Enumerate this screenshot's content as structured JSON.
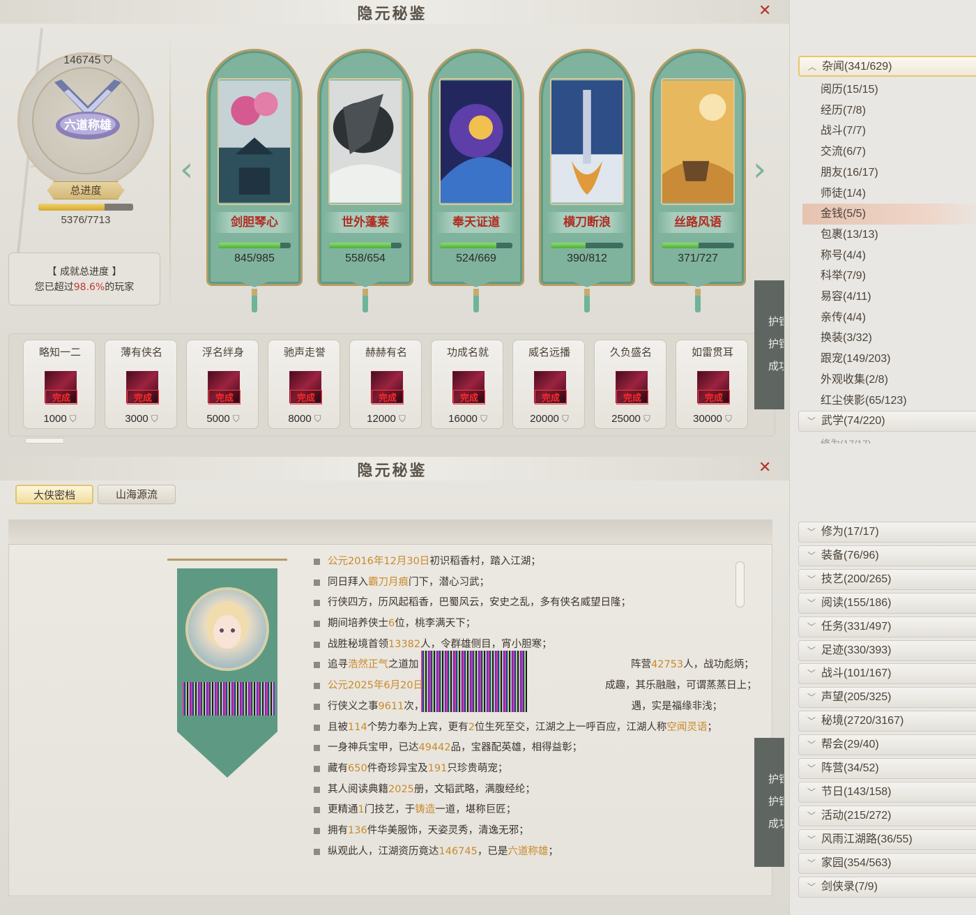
{
  "window_title": "隐元秘鉴",
  "top": {
    "total_score": "146745",
    "emblem_title": "六道称雄",
    "total_progress_label": "总进度",
    "progress_text": "5376/7713",
    "progress_fraction": 0.697,
    "summary_title": "【 成就总进度 】",
    "summary_prefix": "您已超过",
    "summary_pct": "98.6%",
    "summary_suffix": "的玩家",
    "cards": [
      {
        "name": "剑胆琴心",
        "count": "845/985",
        "fraction": 0.858
      },
      {
        "name": "世外蓬莱",
        "count": "558/654",
        "fraction": 0.853
      },
      {
        "name": "奉天证道",
        "count": "524/669",
        "fraction": 0.783
      },
      {
        "name": "横刀断浪",
        "count": "390/812",
        "fraction": 0.48
      },
      {
        "name": "丝路风语",
        "count": "371/727",
        "fraction": 0.51
      }
    ],
    "badges": [
      {
        "name": "略知一二",
        "status": "完成",
        "points": "1000"
      },
      {
        "name": "薄有侠名",
        "status": "完成",
        "points": "3000"
      },
      {
        "name": "浮名绊身",
        "status": "完成",
        "points": "5000"
      },
      {
        "name": "驰声走誉",
        "status": "完成",
        "points": "8000"
      },
      {
        "name": "赫赫有名",
        "status": "完成",
        "points": "12000"
      },
      {
        "name": "功成名就",
        "status": "完成",
        "points": "16000"
      },
      {
        "name": "威名远播",
        "status": "完成",
        "points": "20000"
      },
      {
        "name": "久负盛名",
        "status": "完成",
        "points": "25000"
      },
      {
        "name": "如雷贯耳",
        "status": "完成",
        "points": "30000"
      }
    ],
    "point_symbol": "⛉",
    "dark_tabs": [
      "护镖",
      "护镖",
      "成功"
    ]
  },
  "bottom": {
    "tabs": [
      "大侠密档",
      "山海源流"
    ],
    "lines": [
      [
        {
          "t": "公元2016年12月30日",
          "h": true
        },
        {
          "t": "初识稻香村，踏入江湖；"
        }
      ],
      [
        {
          "t": "同日拜入"
        },
        {
          "t": "霸刀月痕",
          "h": true
        },
        {
          "t": "门下，潜心习武；"
        }
      ],
      [
        {
          "t": "行侠四方，历风起稻香，巴蜀风云，安史之乱，多有侠名威望日隆；"
        }
      ],
      [
        {
          "t": "期间培养侠士"
        },
        {
          "t": "6",
          "h": true
        },
        {
          "t": "位，桃李满天下；"
        }
      ],
      [
        {
          "t": "战胜秘境首领"
        },
        {
          "t": "13382",
          "h": true
        },
        {
          "t": "人，令群雄侧目，宵小胆寒；"
        }
      ],
      [
        {
          "t": "追寻"
        },
        {
          "t": "浩然正气",
          "h": true
        },
        {
          "t": "之道加"
        },
        {
          "t": "　　　　　　　　　　　　　　　　　　　　　"
        },
        {
          "t": "阵营"
        },
        {
          "t": "42753",
          "h": true
        },
        {
          "t": "人，战功彪炳；"
        }
      ],
      [
        {
          "t": "公元2025年6月20日",
          "h": true
        },
        {
          "t": "　　　　　　　　　　　　　　　　　　"
        },
        {
          "t": "成趣，其乐融融，可谓蒸蒸日上；"
        }
      ],
      [
        {
          "t": "行侠义之事"
        },
        {
          "t": "9611",
          "h": true
        },
        {
          "t": "次，"
        },
        {
          "t": "　　　　　　　　　　　　　　　　　　　　　"
        },
        {
          "t": "遇，实是福缘非浅；"
        }
      ],
      [
        {
          "t": "且被"
        },
        {
          "t": "114",
          "h": true
        },
        {
          "t": "个势力奉为上宾，更有"
        },
        {
          "t": "2",
          "h": true
        },
        {
          "t": "位生死至交，江湖之上一呼百应，江湖人称"
        },
        {
          "t": "空闻灵语",
          "h": true
        },
        {
          "t": "；"
        }
      ],
      [
        {
          "t": "一身神兵宝甲，已达"
        },
        {
          "t": "49442",
          "h": true
        },
        {
          "t": "品，宝器配英雄，相得益彰；"
        }
      ],
      [
        {
          "t": "藏有"
        },
        {
          "t": "650",
          "h": true
        },
        {
          "t": "件奇珍异宝及"
        },
        {
          "t": "191",
          "h": true
        },
        {
          "t": "只珍贵萌宠；"
        }
      ],
      [
        {
          "t": "其人阅读典籍"
        },
        {
          "t": "2025",
          "h": true
        },
        {
          "t": "册，文韬武略，满腹经纶；"
        }
      ],
      [
        {
          "t": "更精通"
        },
        {
          "t": "1",
          "h": true
        },
        {
          "t": "门技艺，于"
        },
        {
          "t": "铸造",
          "h": true
        },
        {
          "t": "一道，堪称巨匠；"
        }
      ],
      [
        {
          "t": "拥有"
        },
        {
          "t": "136",
          "h": true
        },
        {
          "t": "件华美服饰，天姿灵秀，清逸无邪；"
        }
      ],
      [
        {
          "t": "纵观此人，江湖资历竟达"
        },
        {
          "t": "146745",
          "h": true
        },
        {
          "t": "，已是"
        },
        {
          "t": "六道称雄",
          "h": true
        },
        {
          "t": "；"
        }
      ]
    ],
    "dark_tabs": [
      "护镖",
      "护镖",
      "成功"
    ]
  },
  "sidebar": {
    "open_category": "杂闻(341/629)",
    "sub_items": [
      "阅历(15/15)",
      "经历(7/8)",
      "战斗(7/7)",
      "交流(6/7)",
      "朋友(16/17)",
      "师徒(1/4)",
      "金钱(5/5)",
      "包裹(13/13)",
      "称号(4/4)",
      "科举(7/9)",
      "易容(4/11)",
      "亲传(4/4)",
      "换装(3/32)",
      "跟宠(149/203)",
      "外观收集(2/8)",
      "红尘侠影(65/123)"
    ],
    "selected_sub": "金钱(5/5)",
    "categories_top": [
      "武学(74/220)"
    ],
    "peek": "修为(17/17)",
    "categories_bottom": [
      "修为(17/17)",
      "装备(76/96)",
      "技艺(200/265)",
      "阅读(155/186)",
      "任务(331/497)",
      "足迹(330/393)",
      "战斗(101/167)",
      "声望(205/325)",
      "秘境(2720/3167)",
      "帮会(29/40)",
      "阵营(34/52)",
      "节日(143/158)",
      "活动(215/272)",
      "风雨江湖路(36/55)",
      "家园(354/563)",
      "剑侠录(7/9)"
    ]
  },
  "colors": {
    "accent_gold": "#c98a2b",
    "card_green": "#7fb39e",
    "close_red": "#b52f2b"
  }
}
